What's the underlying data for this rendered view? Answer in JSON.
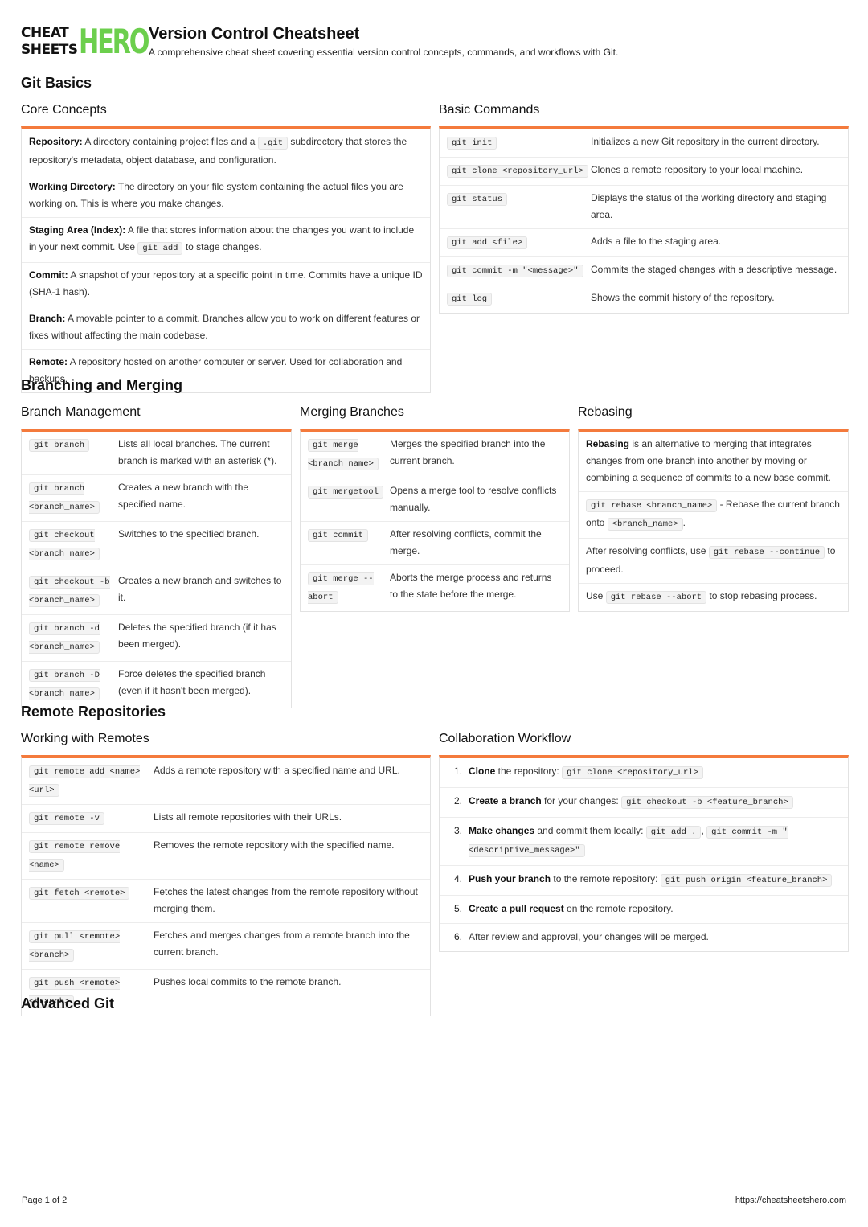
{
  "logo": {
    "line1": "CHEAT",
    "line2": "SHEETS",
    "hero": "HERO"
  },
  "header": {
    "title": "Version Control Cheatsheet",
    "subtitle": "A comprehensive cheat sheet covering essential version control concepts, commands, and workflows with Git."
  },
  "colors": {
    "accent": "#f47a3c",
    "brand_green": "#6ccf4d"
  },
  "sections": {
    "git_basics": "Git Basics",
    "branching": "Branching and Merging",
    "remote": "Remote Repositories",
    "advanced": "Advanced Git"
  },
  "core_concepts": {
    "title": "Core Concepts",
    "items": [
      {
        "term": "Repository:",
        "pre": " A directory containing project files and a ",
        "code": ".git",
        "post": " subdirectory that stores the repository's metadata, object database, and configuration."
      },
      {
        "term": "Working Directory:",
        "pre": " The directory on your file system containing the actual files you are working on. This is where you make changes.",
        "code": "",
        "post": ""
      },
      {
        "term": "Staging Area (Index):",
        "pre": " A file that stores information about the changes you want to include in your next commit. Use ",
        "code": "git add",
        "post": " to stage changes."
      },
      {
        "term": "Commit:",
        "pre": " A snapshot of your repository at a specific point in time. Commits have a unique ID (SHA-1 hash).",
        "code": "",
        "post": ""
      },
      {
        "term": "Branch:",
        "pre": " A movable pointer to a commit. Branches allow you to work on different features or fixes without affecting the main codebase.",
        "code": "",
        "post": ""
      },
      {
        "term": "Remote:",
        "pre": " A repository hosted on another computer or server. Used for collaboration and backups.",
        "code": "",
        "post": ""
      }
    ]
  },
  "basic_commands": {
    "title": "Basic Commands",
    "rows": [
      {
        "cmd": "git init",
        "desc": "Initializes a new Git repository in the current directory."
      },
      {
        "cmd": "git clone <repository_url>",
        "desc": "Clones a remote repository to your local machine."
      },
      {
        "cmd": "git status",
        "desc": "Displays the status of the working directory and staging area."
      },
      {
        "cmd": "git add <file>",
        "desc": "Adds a file to the staging area."
      },
      {
        "cmd": "git commit -m \"<message>\"",
        "desc": "Commits the staged changes with a descriptive message."
      },
      {
        "cmd": "git log",
        "desc": "Shows the commit history of the repository."
      }
    ]
  },
  "branch_management": {
    "title": "Branch Management",
    "rows": [
      {
        "cmd": "git branch",
        "desc": "Lists all local branches. The current branch is marked with an asterisk (*)."
      },
      {
        "cmd": "git branch <branch_name>",
        "desc": "Creates a new branch with the specified name."
      },
      {
        "cmd": "git checkout <branch_name>",
        "desc": "Switches to the specified branch."
      },
      {
        "cmd": "git checkout -b <branch_name>",
        "desc": "Creates a new branch and switches to it."
      },
      {
        "cmd": "git branch -d <branch_name>",
        "desc": "Deletes the specified branch (if it has been merged)."
      },
      {
        "cmd": "git branch -D <branch_name>",
        "desc": "Force deletes the specified branch (even if it hasn't been merged)."
      }
    ]
  },
  "merging": {
    "title": "Merging Branches",
    "rows": [
      {
        "cmd": "git merge <branch_name>",
        "desc": "Merges the specified branch into the current branch."
      },
      {
        "cmd": "git mergetool",
        "desc": "Opens a merge tool to resolve conflicts manually."
      },
      {
        "cmd": "git commit",
        "desc": "After resolving conflicts, commit the merge."
      },
      {
        "cmd": "git merge --abort",
        "desc": "Aborts the merge process and returns to the state before the merge."
      }
    ]
  },
  "rebasing": {
    "title": "Rebasing",
    "intro_bold": "Rebasing",
    "intro_rest": " is an alternative to merging that integrates changes from one branch into another by moving or combining a sequence of commits to a new base commit.",
    "r2_code": "git rebase <branch_name>",
    "r2_mid": " - Rebase the current branch onto ",
    "r2_code2": "<branch_name>",
    "r2_end": ".",
    "r3_pre": "After resolving conflicts, use ",
    "r3_code": "git rebase --continue",
    "r3_post": " to proceed.",
    "r4_pre": "Use ",
    "r4_code": "git rebase --abort",
    "r4_post": " to stop rebasing process."
  },
  "remotes": {
    "title": "Working with Remotes",
    "rows": [
      {
        "cmd": "git remote add <name> <url>",
        "desc": "Adds a remote repository with a specified name and URL."
      },
      {
        "cmd": "git remote -v",
        "desc": "Lists all remote repositories with their URLs."
      },
      {
        "cmd": "git remote remove <name>",
        "desc": "Removes the remote repository with the specified name."
      },
      {
        "cmd": "git fetch <remote>",
        "desc": "Fetches the latest changes from the remote repository without merging them."
      },
      {
        "cmd": "git pull <remote> <branch>",
        "desc": "Fetches and merges changes from a remote branch into the current branch."
      },
      {
        "cmd": "git push <remote> <branch>",
        "desc": "Pushes local commits to the remote branch."
      }
    ]
  },
  "workflow": {
    "title": "Collaboration Workflow",
    "steps": [
      {
        "num": "1.",
        "bold": "Clone",
        "text": " the repository: ",
        "code": "git clone <repository_url>",
        "code2": ""
      },
      {
        "num": "2.",
        "bold": "Create a branch",
        "text": " for your changes: ",
        "code": "git checkout -b <feature_branch>",
        "code2": ""
      },
      {
        "num": "3.",
        "bold": "Make changes",
        "text": " and commit them locally: ",
        "code": "git add .",
        "code2": "git commit -m \"<descriptive_message>\""
      },
      {
        "num": "4.",
        "bold": "Push your branch",
        "text": " to the remote repository: ",
        "code": "git push origin <feature_branch>",
        "code2": ""
      },
      {
        "num": "5.",
        "bold": "Create a pull request",
        "text": " on the remote repository.",
        "code": "",
        "code2": ""
      },
      {
        "num": "6.",
        "bold": "",
        "text": "After review and approval, your changes will be merged.",
        "code": "",
        "code2": ""
      }
    ]
  },
  "footer": {
    "page": "Page 1 of 2",
    "link": "https://cheatsheetshero.com"
  }
}
